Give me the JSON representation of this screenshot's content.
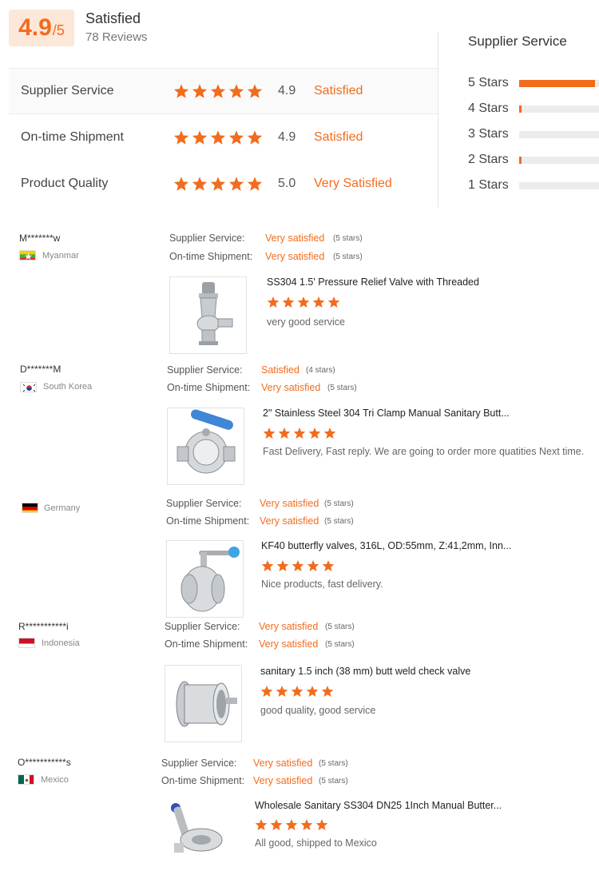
{
  "summary": {
    "score": "4.9",
    "score_denominator": "/5",
    "overall_label": "Satisfied",
    "review_count": "78 Reviews",
    "ratings": [
      {
        "label": "Supplier Service",
        "score": "4.9",
        "desc": "Satisfied",
        "stars": 5
      },
      {
        "label": "On-time Shipment",
        "score": "4.9",
        "desc": "Satisfied",
        "stars": 5
      },
      {
        "label": "Product Quality",
        "score": "5.0",
        "desc": "Very Satisfied",
        "stars": 5
      }
    ]
  },
  "distribution": {
    "title": "Supplier Service",
    "bars": [
      {
        "label": "5 Stars",
        "fraction": 0.95
      },
      {
        "label": "4 Stars",
        "fraction": 0.03
      },
      {
        "label": "3 Stars",
        "fraction": 0.0
      },
      {
        "label": "2 Stars",
        "fraction": 0.03
      },
      {
        "label": "1 Stars",
        "fraction": 0.0
      }
    ]
  },
  "labels": {
    "supplier_service": "Supplier Service:",
    "ontime_shipment": "On-time Shipment:"
  },
  "reviews": [
    {
      "name": "M*******w",
      "country": "Myanmar",
      "flag": "myanmar",
      "supplier_value": "Very satisfied",
      "supplier_stars": "(5 stars)",
      "shipment_value": "Very satisfied",
      "shipment_stars": "(5 stars)",
      "product": "SS304 1.5' Pressure Relief Valve with Threaded",
      "comment": "very good service",
      "stars": 5
    },
    {
      "name": "D*******M",
      "country": "South Korea",
      "flag": "korea",
      "supplier_value": "Satisfied",
      "supplier_stars": "(4 stars)",
      "shipment_value": "Very satisfied",
      "shipment_stars": "(5 stars)",
      "product": "2\" Stainless Steel 304 Tri Clamp Manual Sanitary Butt...",
      "comment": "Fast Delivery, Fast reply. We are going to order more quatities Next time.",
      "stars": 5
    },
    {
      "name": "",
      "country": "Germany",
      "flag": "germany",
      "supplier_value": "Very satisfied",
      "supplier_stars": "(5 stars)",
      "shipment_value": "Very satisfied",
      "shipment_stars": "(5 stars)",
      "product": "KF40 butterfly valves, 316L, OD:55mm, Z:41,2mm, Inn...",
      "comment": "Nice products, fast delivery.",
      "stars": 5
    },
    {
      "name": "R***********i",
      "country": "Indonesia",
      "flag": "indonesia",
      "supplier_value": "Very satisfied",
      "supplier_stars": "(5 stars)",
      "shipment_value": "Very satisfied",
      "shipment_stars": "(5 stars)",
      "product": "sanitary 1.5 inch (38 mm) butt weld check valve",
      "comment": "good quality, good service",
      "stars": 5
    },
    {
      "name": "O***********s",
      "country": "Mexico",
      "flag": "mexico",
      "supplier_value": "Very satisfied",
      "supplier_stars": "(5 stars)",
      "shipment_value": "Very satisfied",
      "shipment_stars": "(5 stars)",
      "product": "Wholesale Sanitary SS304 DN25 1Inch Manual Butter...",
      "comment": "All good, shipped to Mexico",
      "stars": 5
    }
  ],
  "colors": {
    "accent": "#f26c1d",
    "score_bg": "#fde7d9",
    "bar_bg": "#ececec"
  }
}
